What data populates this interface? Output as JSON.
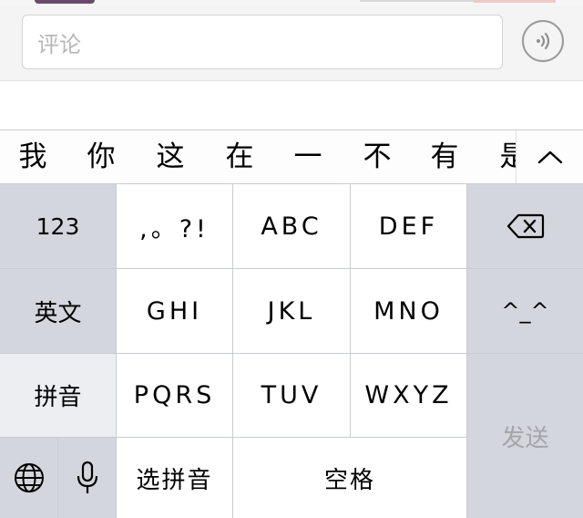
{
  "comment": {
    "placeholder": "评论"
  },
  "candidates": [
    "我",
    "你",
    "这",
    "在",
    "一",
    "不",
    "有",
    "是"
  ],
  "keyboard": {
    "left": {
      "numbers": "123",
      "english": "英文",
      "pinyin": "拼音"
    },
    "grid": [
      ",。?!",
      "ABC",
      "DEF",
      "GHI",
      "JKL",
      "MNO",
      "PQRS",
      "TUV",
      "WXYZ"
    ],
    "select_pinyin": "选拼音",
    "space": "空格",
    "emoticon": "^_^",
    "send": "发送"
  },
  "icons": {
    "voice": "voice-icon",
    "collapse": "chevron-up-icon",
    "delete": "delete-icon",
    "globe": "globe-icon",
    "mic": "microphone-icon"
  },
  "colors": {
    "keyboard_bg": "#c9cdd3",
    "function_key": "#d3d6dc",
    "letter_key": "#ffffff",
    "placeholder": "#b6b6b6"
  }
}
